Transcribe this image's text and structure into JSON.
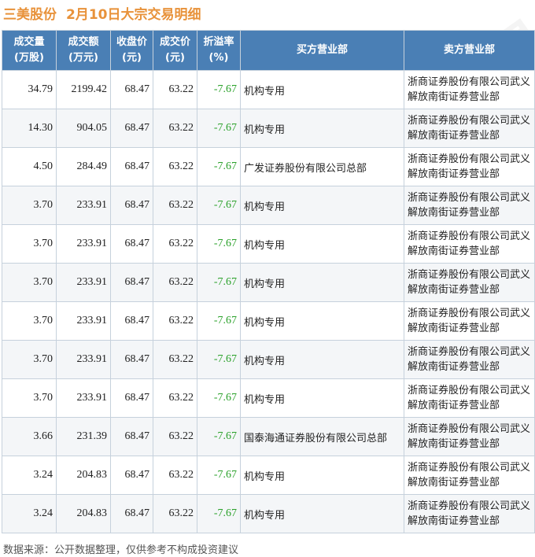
{
  "title": {
    "stock": "三美股份",
    "subtitle": "2月10日大宗交易明细"
  },
  "table": {
    "headers": [
      [
        "成交量",
        "(万股)"
      ],
      [
        "成交额",
        "(万元)"
      ],
      [
        "收盘价",
        "(元)"
      ],
      [
        "成交价",
        "(元)"
      ],
      [
        "折溢率",
        "(%)"
      ],
      [
        "买方营业部"
      ],
      [
        "卖方营业部"
      ]
    ],
    "rows": [
      {
        "volume": "34.79",
        "amount": "2199.42",
        "close": "68.47",
        "price": "63.22",
        "premium": "-7.67",
        "buyer": "机构专用",
        "seller": "浙商证券股份有限公司武义解放南街证券营业部"
      },
      {
        "volume": "14.30",
        "amount": "904.05",
        "close": "68.47",
        "price": "63.22",
        "premium": "-7.67",
        "buyer": "机构专用",
        "seller": "浙商证券股份有限公司武义解放南街证券营业部"
      },
      {
        "volume": "4.50",
        "amount": "284.49",
        "close": "68.47",
        "price": "63.22",
        "premium": "-7.67",
        "buyer": "广发证券股份有限公司总部",
        "seller": "浙商证券股份有限公司武义解放南街证券营业部"
      },
      {
        "volume": "3.70",
        "amount": "233.91",
        "close": "68.47",
        "price": "63.22",
        "premium": "-7.67",
        "buyer": "机构专用",
        "seller": "浙商证券股份有限公司武义解放南街证券营业部"
      },
      {
        "volume": "3.70",
        "amount": "233.91",
        "close": "68.47",
        "price": "63.22",
        "premium": "-7.67",
        "buyer": "机构专用",
        "seller": "浙商证券股份有限公司武义解放南街证券营业部"
      },
      {
        "volume": "3.70",
        "amount": "233.91",
        "close": "68.47",
        "price": "63.22",
        "premium": "-7.67",
        "buyer": "机构专用",
        "seller": "浙商证券股份有限公司武义解放南街证券营业部"
      },
      {
        "volume": "3.70",
        "amount": "233.91",
        "close": "68.47",
        "price": "63.22",
        "premium": "-7.67",
        "buyer": "机构专用",
        "seller": "浙商证券股份有限公司武义解放南街证券营业部"
      },
      {
        "volume": "3.70",
        "amount": "233.91",
        "close": "68.47",
        "price": "63.22",
        "premium": "-7.67",
        "buyer": "机构专用",
        "seller": "浙商证券股份有限公司武义解放南街证券营业部"
      },
      {
        "volume": "3.70",
        "amount": "233.91",
        "close": "68.47",
        "price": "63.22",
        "premium": "-7.67",
        "buyer": "机构专用",
        "seller": "浙商证券股份有限公司武义解放南街证券营业部"
      },
      {
        "volume": "3.66",
        "amount": "231.39",
        "close": "68.47",
        "price": "63.22",
        "premium": "-7.67",
        "buyer": "国泰海通证券股份有限公司总部",
        "seller": "浙商证券股份有限公司武义解放南街证券营业部"
      },
      {
        "volume": "3.24",
        "amount": "204.83",
        "close": "68.47",
        "price": "63.22",
        "premium": "-7.67",
        "buyer": "机构专用",
        "seller": "浙商证券股份有限公司武义解放南街证券营业部"
      },
      {
        "volume": "3.24",
        "amount": "204.83",
        "close": "68.47",
        "price": "63.22",
        "premium": "-7.67",
        "buyer": "机构专用",
        "seller": "浙商证券股份有限公司武义解放南街证券营业部"
      }
    ]
  },
  "footer": "数据来源：公开数据整理，仅供参考不构成投资建议",
  "watermark": "证券之星",
  "colors": {
    "title": "#e8923a",
    "header_bg": "#4a7fb5",
    "negative": "#2aa12a"
  }
}
